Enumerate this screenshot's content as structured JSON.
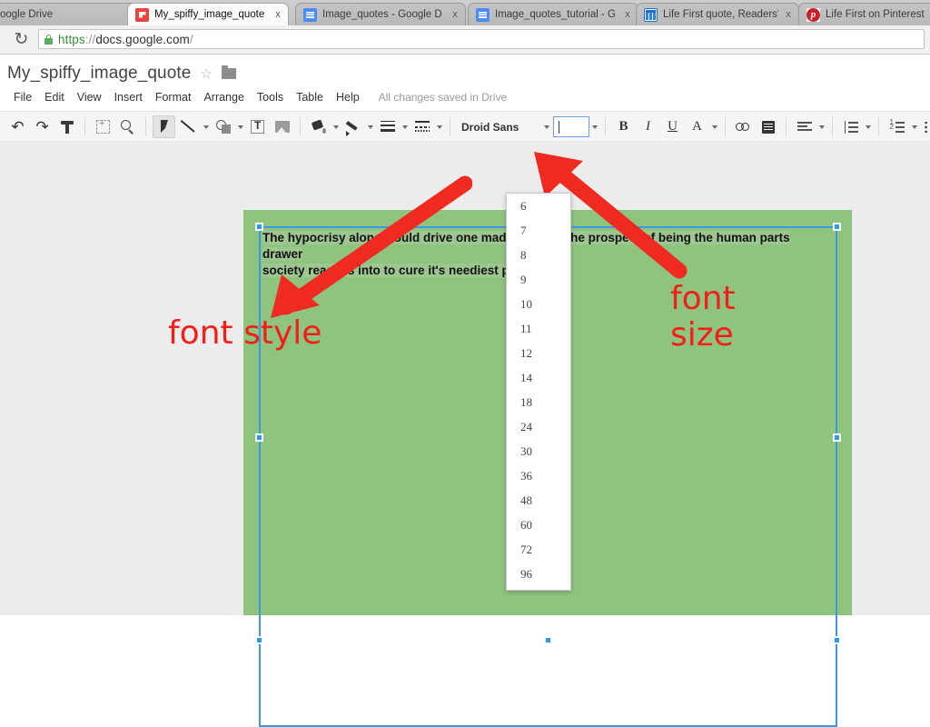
{
  "browser": {
    "tabs": [
      {
        "title": "- Google Drive",
        "favicon": "google-drive-icon",
        "active": false
      },
      {
        "title": "My_spiffy_image_quote -",
        "favicon": "google-slides-icon",
        "active": true
      },
      {
        "title": "Image_quotes - Google D",
        "favicon": "google-docs-icon",
        "active": false
      },
      {
        "title": "Image_quotes_tutorial - G",
        "favicon": "google-docs-icon",
        "active": false
      },
      {
        "title": "Life First quote, Readers'",
        "favicon": "google-sheets-icon",
        "active": false
      },
      {
        "title": "Life First on Pinterest",
        "favicon": "pinterest-icon",
        "active": false
      }
    ],
    "close_label": "x",
    "reload_label": "↻",
    "url_scheme": "https",
    "url_separator": "://",
    "url_host": "docs.google.com",
    "url_trailing": "/"
  },
  "docs": {
    "title": "My_spiffy_image_quote",
    "star_label": "☆",
    "menus": [
      "File",
      "Edit",
      "View",
      "Insert",
      "Format",
      "Arrange",
      "Tools",
      "Table",
      "Help"
    ],
    "save_status": "All changes saved in Drive"
  },
  "toolbar": {
    "font_family": "Droid Sans",
    "font_size_value": "",
    "buttons": [
      {
        "name": "undo",
        "glyph": "↶"
      },
      {
        "name": "redo",
        "glyph": "↷"
      },
      {
        "name": "paint-format",
        "glyph": ""
      },
      {
        "name": "crop",
        "glyph": ""
      },
      {
        "name": "zoom",
        "glyph": ""
      },
      {
        "name": "select",
        "glyph": ""
      },
      {
        "name": "line",
        "glyph": ""
      },
      {
        "name": "shape",
        "glyph": ""
      },
      {
        "name": "text-box",
        "glyph": ""
      },
      {
        "name": "image",
        "glyph": ""
      },
      {
        "name": "fill-color",
        "glyph": ""
      },
      {
        "name": "line-color",
        "glyph": ""
      },
      {
        "name": "line-weight",
        "glyph": ""
      },
      {
        "name": "line-dash",
        "glyph": ""
      },
      {
        "name": "bold",
        "glyph": "B"
      },
      {
        "name": "italic",
        "glyph": "I"
      },
      {
        "name": "underline",
        "glyph": "U"
      },
      {
        "name": "text-color",
        "glyph": "A"
      },
      {
        "name": "insert-link",
        "glyph": ""
      },
      {
        "name": "comment",
        "glyph": ""
      },
      {
        "name": "align",
        "glyph": ""
      },
      {
        "name": "line-spacing",
        "glyph": ""
      },
      {
        "name": "numbered-list",
        "glyph": ""
      },
      {
        "name": "bulleted-list",
        "glyph": ""
      },
      {
        "name": "decrease-indent",
        "glyph": ""
      },
      {
        "name": "increase-indent",
        "glyph": ""
      }
    ]
  },
  "font_size_menu": {
    "open": true,
    "options": [
      "6",
      "7",
      "8",
      "9",
      "10",
      "11",
      "12",
      "14",
      "18",
      "24",
      "30",
      "36",
      "48",
      "60",
      "72",
      "96"
    ]
  },
  "slide": {
    "background_color": "#8fc47f",
    "text_line1": "The hypocrisy alone would drive one mad, let alone the prospect of being the human parts drawer",
    "text_line2": "society reaches into to cure it's neediest patients"
  },
  "annotations": {
    "color": "#f21f18",
    "font_style_label_line1": "font",
    "font_style_label_line2": "style",
    "font_style_label": "font style",
    "font_size_label_line1": "font",
    "font_size_label_line2": "size"
  }
}
